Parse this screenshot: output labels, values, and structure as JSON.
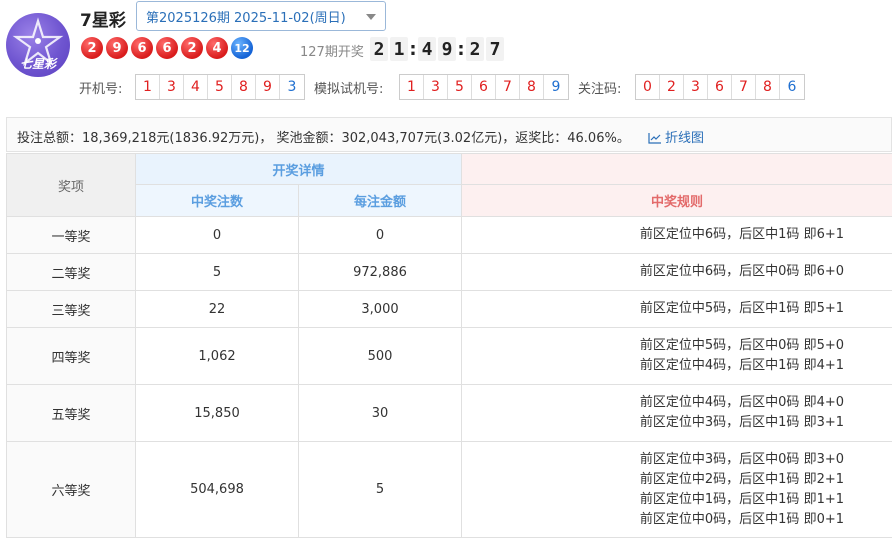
{
  "header": {
    "title": "7星彩",
    "logo_text": "七星彩",
    "issue_select": "第2025126期 2025-11-02(周日)",
    "balls": [
      {
        "n": "2",
        "c": "red"
      },
      {
        "n": "9",
        "c": "red"
      },
      {
        "n": "6",
        "c": "red"
      },
      {
        "n": "6",
        "c": "red"
      },
      {
        "n": "2",
        "c": "red"
      },
      {
        "n": "4",
        "c": "red"
      },
      {
        "n": "12",
        "c": "blue"
      }
    ],
    "next_draw_label": "127期开奖",
    "countdown": [
      "2",
      "1",
      ":",
      "4",
      "9",
      ":",
      "2",
      "7"
    ]
  },
  "number_rows": {
    "open_label": "开机号:",
    "open_numbers": [
      "1",
      "3",
      "4",
      "5",
      "8",
      "9",
      "3"
    ],
    "sim_label": "模拟试机号:",
    "sim_numbers": [
      "1",
      "3",
      "5",
      "6",
      "7",
      "8",
      "9"
    ],
    "focus_label": "关注码:",
    "focus_numbers": [
      "0",
      "2",
      "3",
      "6",
      "7",
      "8",
      "6"
    ]
  },
  "summary": {
    "text": "投注总额：18,369,218元(1836.92万元)， 奖池金额：302,043,707元(3.02亿元)，返奖比：46.06%。",
    "chart_link": "折线图"
  },
  "table": {
    "col_prize": "奖项",
    "col_group": "开奖详情",
    "col_count": "中奖注数",
    "col_amount": "每注金额",
    "col_rule": "中奖规则",
    "rows": [
      {
        "rank": "一等奖",
        "count": "0",
        "amount": "0",
        "rules": [
          "前区定位中6码，后区中1码 即6+1"
        ]
      },
      {
        "rank": "二等奖",
        "count": "5",
        "amount": "972,886",
        "rules": [
          "前区定位中6码，后区中0码 即6+0"
        ]
      },
      {
        "rank": "三等奖",
        "count": "22",
        "amount": "3,000",
        "rules": [
          "前区定位中5码，后区中1码 即5+1"
        ]
      },
      {
        "rank": "四等奖",
        "count": "1,062",
        "amount": "500",
        "rules": [
          "前区定位中5码，后区中0码 即5+0",
          "前区定位中4码，后区中1码 即4+1"
        ]
      },
      {
        "rank": "五等奖",
        "count": "15,850",
        "amount": "30",
        "rules": [
          "前区定位中4码，后区中0码 即4+0",
          "前区定位中3码，后区中1码 即3+1"
        ]
      },
      {
        "rank": "六等奖",
        "count": "504,698",
        "amount": "5",
        "rules": [
          "前区定位中3码，后区中0码 即3+0",
          "前区定位中2码，后区中1码 即2+1",
          "前区定位中1码，后区中1码 即1+1",
          "前区定位中0码，后区中1码 即0+1"
        ]
      }
    ]
  }
}
